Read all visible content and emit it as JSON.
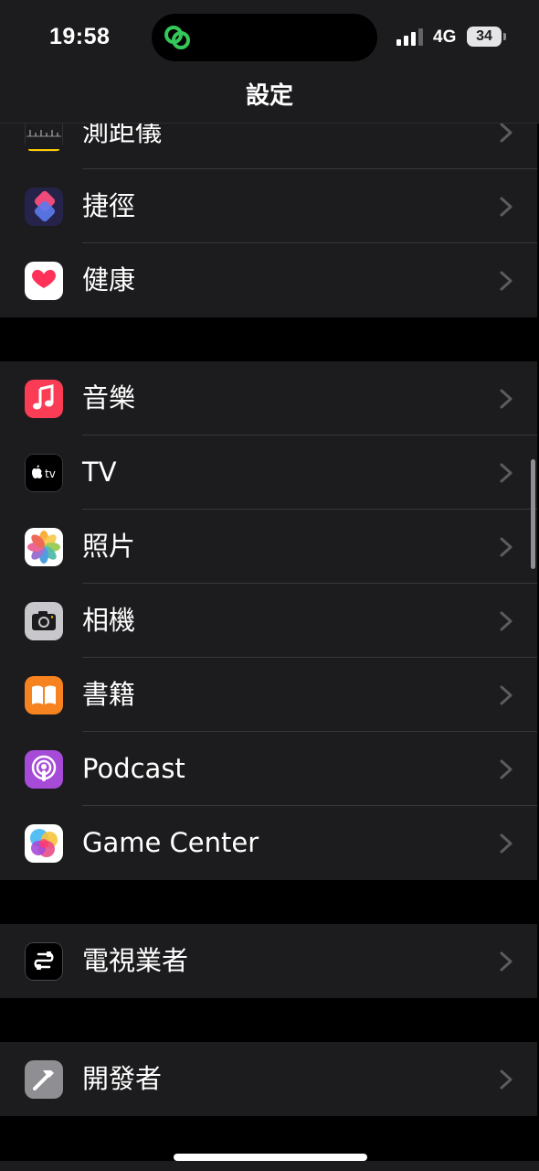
{
  "status_bar": {
    "time": "19:58",
    "network": "4G",
    "battery": "34"
  },
  "nav": {
    "title": "設定"
  },
  "rows": [
    {
      "label": "測距儀",
      "icon": "measure-icon"
    },
    {
      "label": "捷徑",
      "icon": "shortcuts-icon"
    },
    {
      "label": "健康",
      "icon": "health-icon"
    },
    {
      "label": "音樂",
      "icon": "music-icon"
    },
    {
      "label": "TV",
      "icon": "tv-icon"
    },
    {
      "label": "照片",
      "icon": "photos-icon"
    },
    {
      "label": "相機",
      "icon": "camera-icon"
    },
    {
      "label": "書籍",
      "icon": "books-icon"
    },
    {
      "label": "Podcast",
      "icon": "podcast-icon"
    },
    {
      "label": "Game Center",
      "icon": "game-center-icon"
    },
    {
      "label": "電視業者",
      "icon": "tv-provider-icon"
    },
    {
      "label": "開發者",
      "icon": "developer-icon"
    }
  ],
  "icon_tv_text": "tv",
  "colors": {
    "background": "#000000",
    "cell": "#1c1c1e",
    "separator": "#38383a",
    "chevron": "#5b5b60",
    "music": "#fa3c55",
    "podcast": "#a64bd8",
    "books": "#f6831f",
    "health_heart": "#ff3158",
    "link_green": "#34c759"
  }
}
